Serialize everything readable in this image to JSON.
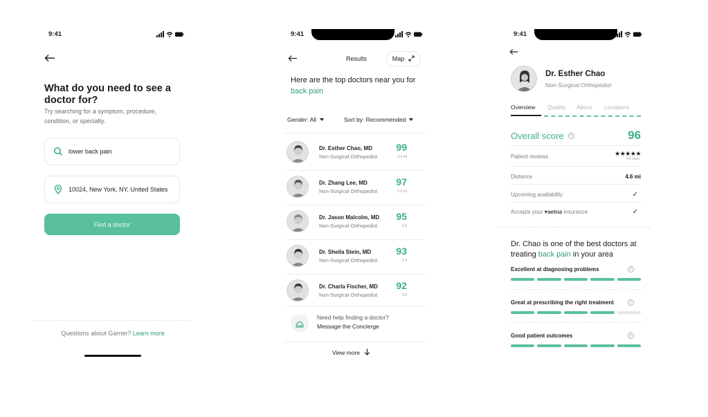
{
  "status": {
    "time": "9:41"
  },
  "search_screen": {
    "title": "What do you need to see a doctor for?",
    "subtitle": "Try searching for a symptom, procedure, condition, or specialty.",
    "search_value": "lower back pain",
    "location_value": "10024, New York, NY, United States",
    "find_button": "Find a doctor",
    "footer_text": "Questions about Garner?",
    "footer_link": "Learn more"
  },
  "results_screen": {
    "title": "Results",
    "map_label": "Map",
    "heading_text": "Here are the top doctors near you for",
    "heading_accent": "back pain",
    "gender_filter": "Gender: All",
    "sort_filter": "Sort by: Recommended",
    "doctors": [
      {
        "name": "Dr. Esther Chao, MD",
        "specialty": "Non-Surgical Orthopedist",
        "score": "99",
        "distance": "0.4 mi"
      },
      {
        "name": "Dr. Zhang Lee, MD",
        "specialty": "Non-Surgical Orthopedist",
        "score": "97",
        "distance": "1.0 mi"
      },
      {
        "name": "Dr. Jason Malcolm, MD",
        "specialty": "Non-Surgical Orthopedist",
        "score": "95",
        "distance": "0.8"
      },
      {
        "name": "Dr. Sheila Stein, MD",
        "specialty": "Non-Surgical Orthopedist",
        "score": "93",
        "distance": "1.4"
      },
      {
        "name": "Dr. Charla Fischer, MD",
        "specialty": "Non-Surgical Orthopedist",
        "score": "92",
        "distance": "0.8"
      }
    ],
    "concierge_line1": "Need help finding a doctor?",
    "concierge_line2": "Message the Concierge",
    "view_more": "View more"
  },
  "profile_screen": {
    "name": "Dr. Esther Chao",
    "specialty": "Non-Surgical Orthopedist",
    "tabs": [
      "Overview",
      "Quality",
      "About",
      "Locations"
    ],
    "overall_label": "Overall score",
    "overall_score": "96",
    "patient_reviews_label": "Patient reviews",
    "stars": "★★★★★",
    "stars_caption": "4.9 stars",
    "distance_label": "Distance",
    "distance_value": "4.6 mi",
    "availability_label": "Upcoming availability",
    "insurance_prefix": "Accepts your",
    "insurance_brand": "♥aetna",
    "insurance_suffix": "insurance",
    "summary_prefix": "Dr. Chao is one of the best doctors at treating",
    "summary_accent": "back pain",
    "summary_suffix": "in your area",
    "qualities": [
      {
        "label": "Excellent at diagnosing problems",
        "level": 5
      },
      {
        "label": "Great at prescribing the right treatment",
        "level": 4
      },
      {
        "label": "Good patient outcomes",
        "level": 5
      }
    ],
    "quality_max": 5
  },
  "colors": {
    "accent": "#3fae88",
    "button": "#59bf9c"
  }
}
